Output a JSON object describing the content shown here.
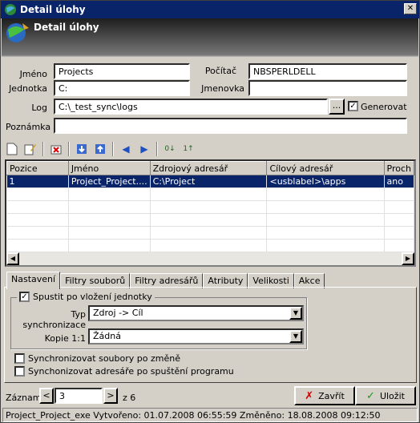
{
  "window": {
    "title": "Detail úlohy",
    "header_title": "Detail úlohy"
  },
  "form": {
    "jmeno_label": "Jméno",
    "jmeno_value": "Projects",
    "pocitac_label": "Počítač",
    "pocitac_value": "NBSPERLDELL",
    "jednotka_label": "Jednotka",
    "jednotka_value": "C:",
    "jmenovka_label": "Jmenovka",
    "jmenovka_value": "",
    "log_label": "Log",
    "log_value": "C:\\_test_sync\\logs",
    "browse_label": "...",
    "generovat_label": "Generovat",
    "poznamka_label": "Poznámka",
    "poznamka_value": ""
  },
  "grid": {
    "columns": [
      "Pozice",
      "Jméno",
      "Zdrojový adresář",
      "Cílový adresář",
      "Proch"
    ],
    "rows": [
      [
        "1",
        "Project_Project....",
        "C:\\Project",
        "<usblabel>\\apps",
        "ano"
      ]
    ]
  },
  "tabs": [
    "Nastavení",
    "Filtry souborů",
    "Filtry adresářů",
    "Atributy",
    "Velikosti",
    "Akce"
  ],
  "settings": {
    "spustit_label": "Spustit po vložení jednotky",
    "typ_label": "Typ synchronizace",
    "typ_value": "Zdroj -> Cíl",
    "kopie_label": "Kopie 1:1",
    "kopie_value": "Žádná",
    "sync_files_label": "Synchronizovat soubory po změně",
    "sync_dirs_label": "Synchonizovat adresáře po spuštění programu"
  },
  "nav": {
    "zaznam_label": "Záznam",
    "prev": "<",
    "value": "3",
    "next": ">",
    "total": "z 6"
  },
  "buttons": {
    "zavrit": "Zavřít",
    "ulozit": "Uložit"
  },
  "status": {
    "text": "Project_Project_exe  Vytvořeno: 01.07.2008 06:55:59  Změněno: 18.08.2008 09:12:50"
  }
}
